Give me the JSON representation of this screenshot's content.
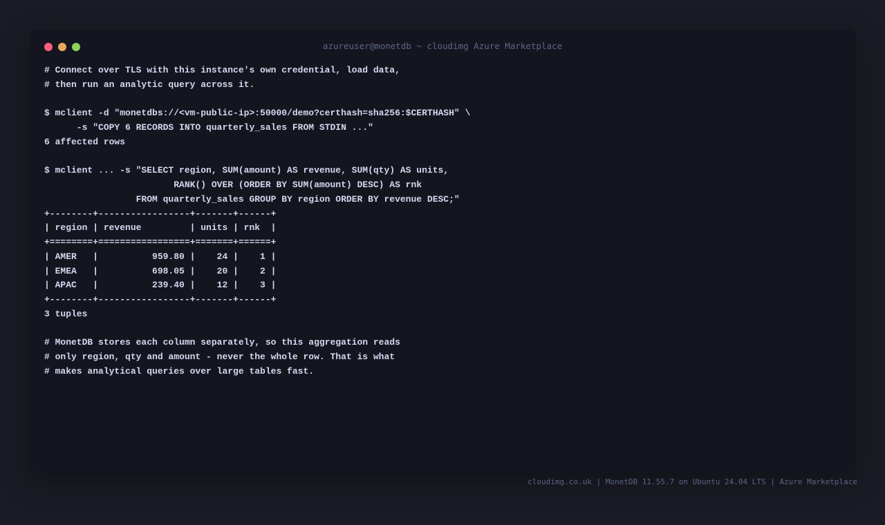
{
  "window": {
    "title": "azureuser@monetdb ~ cloudimg Azure Marketplace",
    "controls": {
      "close_color": "#ff5f7e",
      "minimize_color": "#e8a85c",
      "maximize_color": "#8ed35c"
    }
  },
  "terminal": {
    "lines": [
      "# Connect over TLS with this instance's own credential, load data,",
      "# then run an analytic query across it.",
      "",
      "$ mclient -d \"monetdbs://<vm-public-ip>:50000/demo?certhash=sha256:$CERTHASH\" \\",
      "      -s \"COPY 6 RECORDS INTO quarterly_sales FROM STDIN ...\"",
      "6 affected rows",
      "",
      "$ mclient ... -s \"SELECT region, SUM(amount) AS revenue, SUM(qty) AS units,",
      "                        RANK() OVER (ORDER BY SUM(amount) DESC) AS rnk",
      "                 FROM quarterly_sales GROUP BY region ORDER BY revenue DESC;\"",
      "+--------+-----------------+-------+------+",
      "| region | revenue         | units | rnk  |",
      "+========+=================+=======+======+",
      "| AMER   |          959.80 |    24 |    1 |",
      "| EMEA   |          698.05 |    20 |    2 |",
      "| APAC   |          239.40 |    12 |    3 |",
      "+--------+-----------------+-------+------+",
      "3 tuples",
      "",
      "# MonetDB stores each column separately, so this aggregation reads",
      "# only region, qty and amount - never the whole row. That is what",
      "# makes analytical queries over large tables fast."
    ]
  },
  "footer": {
    "text": "cloudimg.co.uk | MonetDB 11.55.7 on Ubuntu 24.04 LTS | Azure Marketplace"
  }
}
